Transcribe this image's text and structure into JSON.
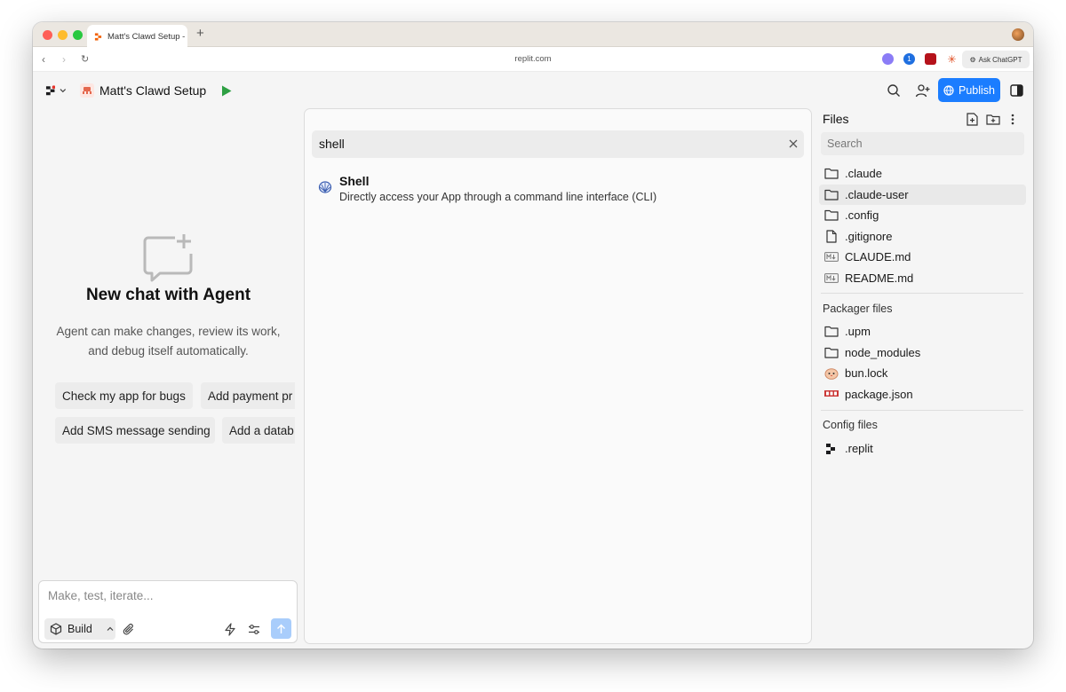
{
  "browser": {
    "tab_title": "Matt's Clawd Setup -",
    "url": "replit.com",
    "ask_chatgpt": "Ask ChatGPT"
  },
  "header": {
    "project_name": "Matt's Clawd Setup",
    "publish_label": "Publish"
  },
  "chat": {
    "heading": "New chat with Agent",
    "description": "Agent can make changes, review its work, and debug itself automatically.",
    "suggestions": [
      "Check my app for bugs",
      "Add payment pr",
      "Add SMS message sending",
      "Add a datab"
    ],
    "input_placeholder": "Make, test, iterate...",
    "build_label": "Build"
  },
  "command": {
    "query": "shell",
    "results": [
      {
        "title": "Shell",
        "description": "Directly access your App through a command line interface (CLI)",
        "icon": "shell-icon"
      }
    ]
  },
  "files": {
    "title": "Files",
    "search_placeholder": "Search",
    "items": [
      {
        "name": ".claude",
        "icon": "folder-icon"
      },
      {
        "name": ".claude-user",
        "icon": "folder-icon",
        "selected": true
      },
      {
        "name": ".config",
        "icon": "folder-icon"
      },
      {
        "name": ".gitignore",
        "icon": "file-icon"
      },
      {
        "name": "CLAUDE.md",
        "icon": "markdown-icon"
      },
      {
        "name": "README.md",
        "icon": "markdown-icon"
      }
    ],
    "packager_title": "Packager files",
    "packager_items": [
      {
        "name": ".upm",
        "icon": "folder-icon"
      },
      {
        "name": "node_modules",
        "icon": "folder-icon"
      },
      {
        "name": "bun.lock",
        "icon": "bun-icon"
      },
      {
        "name": "package.json",
        "icon": "npm-icon"
      }
    ],
    "config_title": "Config files",
    "config_items": [
      {
        "name": ".replit",
        "icon": "replit-icon"
      }
    ]
  },
  "colors": {
    "accent": "#1b7dff",
    "run_green": "#2ea043",
    "replit_orange": "#f26207"
  }
}
